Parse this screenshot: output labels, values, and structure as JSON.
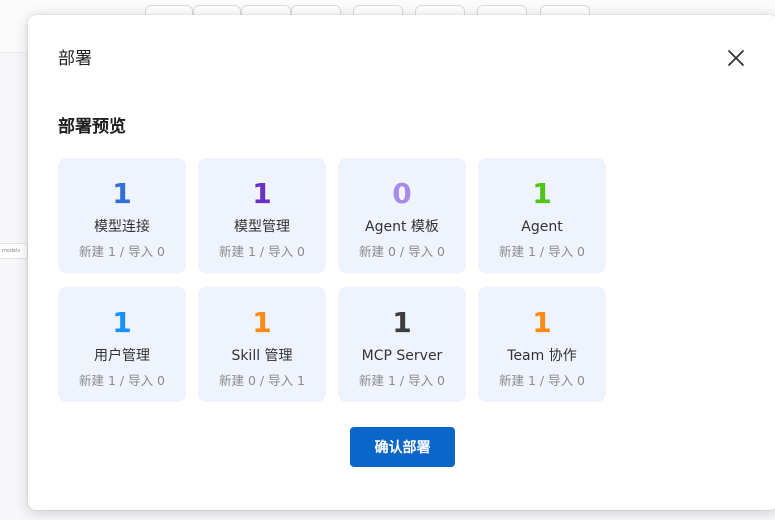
{
  "background": {
    "node_label": "models"
  },
  "modal": {
    "title": "部署",
    "section_title": "部署预览",
    "confirm_label": "确认部署"
  },
  "cards": [
    {
      "count": "1",
      "name": "模型连接",
      "detail": "新建 1 / 导入 0",
      "color": "#2f6fd6"
    },
    {
      "count": "1",
      "name": "模型管理",
      "detail": "新建 1 / 导入 0",
      "color": "#6a2fc4"
    },
    {
      "count": "0",
      "name": "Agent 模板",
      "detail": "新建 0 / 导入 0",
      "color": "#a88be8"
    },
    {
      "count": "1",
      "name": "Agent",
      "detail": "新建 1 / 导入 0",
      "color": "#52c41a"
    },
    {
      "count": "1",
      "name": "用户管理",
      "detail": "新建 1 / 导入 0",
      "color": "#1890ff"
    },
    {
      "count": "1",
      "name": "Skill 管理",
      "detail": "新建 0 / 导入 1",
      "color": "#fa8c16"
    },
    {
      "count": "1",
      "name": "MCP Server",
      "detail": "新建 1 / 导入 0",
      "color": "#3d3d3d"
    },
    {
      "count": "1",
      "name": "Team 协作",
      "detail": "新建 1 / 导入 0",
      "color": "#fa8c16"
    }
  ],
  "colors": {
    "primary": "#0a66c8",
    "card_bg": "#eef3fd"
  }
}
